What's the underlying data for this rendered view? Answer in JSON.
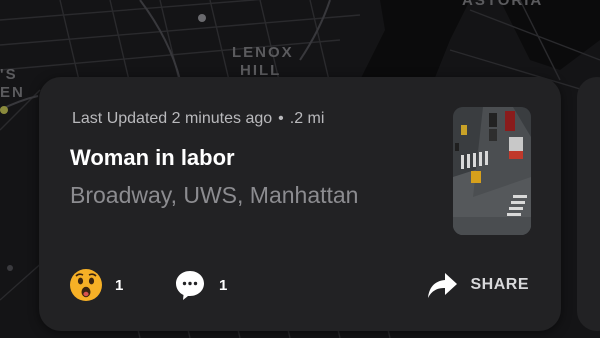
{
  "map": {
    "labels": {
      "astoria": "ASTORIA",
      "lenox_line1": "LENOX",
      "lenox_line2": "HILL",
      "edge_line1": "'S",
      "edge_line2": "EN"
    },
    "colors": {
      "background": "#121214",
      "roads": "#2b2b2e",
      "water": "#0a0a0b"
    }
  },
  "card": {
    "meta": {
      "updated": "Last Updated 2 minutes ago",
      "separator": "•",
      "distance": ".2 mi"
    },
    "title": "Woman in labor",
    "location": "Broadway, UWS, Manhattan",
    "thumbnail_icon": "street-video-thumbnail",
    "actions": {
      "reaction_icon": "surprised-face-icon",
      "reaction_count": "1",
      "comment_icon": "comment-bubble-icon",
      "comment_count": "1",
      "share_icon": "share-arrow-icon",
      "share_label": "SHARE"
    }
  },
  "colors": {
    "card": "#222224",
    "text_primary": "#ffffff",
    "text_secondary": "#8c8c90",
    "emoji": "#f6b026"
  }
}
